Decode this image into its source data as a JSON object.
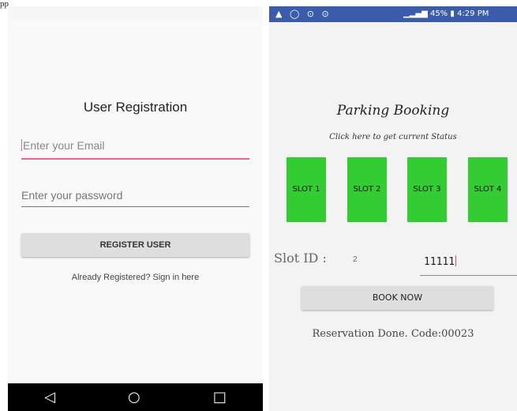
{
  "caption": "pp",
  "left_screen": {
    "title": "User Registration",
    "email_placeholder": "Enter your Email",
    "password_placeholder": "Enter your password",
    "register_button": "REGISTER USER",
    "signin_link": "Already Registered? Sign in here",
    "nav": {
      "back": "◁",
      "home": "○",
      "recents": "□"
    }
  },
  "right_screen": {
    "status_bar": {
      "left_icons": "▲ ◯ ⊙ ⊙",
      "battery": "45%",
      "time": "4:29 PM"
    },
    "title": "Parking Booking",
    "status_link": "Click here to get current Status",
    "slots": [
      "SLOT 1",
      "SLOT 2",
      "SLOT 3",
      "SLOT 4"
    ],
    "slot_id_label": "Slot ID :",
    "slot_id_value": "2",
    "code_value": "11111",
    "book_button": "BOOK NOW",
    "reservation_text": "Reservation Done. Code:00023",
    "slot_color": "#33cc33"
  }
}
